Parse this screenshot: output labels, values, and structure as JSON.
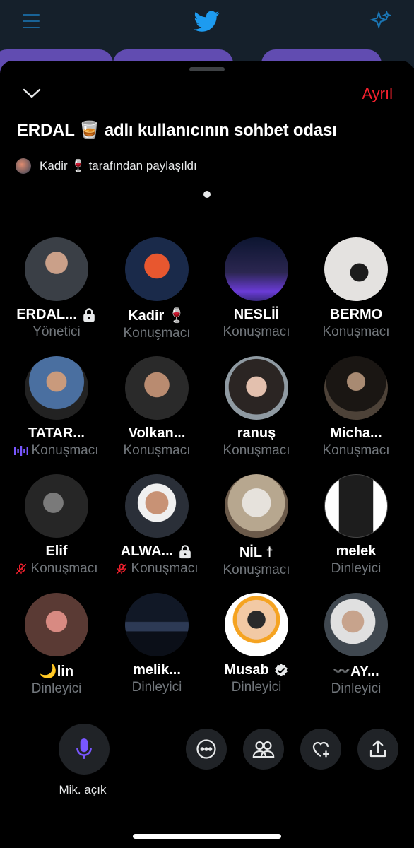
{
  "header": {
    "leave_label": "Ayrıl"
  },
  "room": {
    "title": "ERDAL 🥃 adlı kullanıcının sohbet odası",
    "shared_by_name": "Kadir 🍷",
    "shared_by_suffix": "tarafından paylaşıldı"
  },
  "participants": [
    {
      "name": "ERDAL...",
      "role": "Yönetici",
      "badge": "lock"
    },
    {
      "name": "Kadir 🍷",
      "role": "Konuşmacı"
    },
    {
      "name": "NESLİİ",
      "role": "Konuşmacı"
    },
    {
      "name": "BERMO",
      "role": "Konuşmacı"
    },
    {
      "name": "TATAR...",
      "role": "Konuşmacı",
      "status": "speaking"
    },
    {
      "name": "Volkan...",
      "role": "Konuşmacı"
    },
    {
      "name": "ranuş",
      "role": "Konuşmacı"
    },
    {
      "name": "Micha...",
      "role": "Konuşmacı"
    },
    {
      "name": "Elif",
      "role": "Konuşmacı",
      "status": "muted"
    },
    {
      "name": "ALWA...",
      "role": "Konuşmacı",
      "status": "muted",
      "badge": "lock"
    },
    {
      "name": "NİL ☨",
      "role": "Konuşmacı"
    },
    {
      "name": "melek",
      "role": "Dinleyici"
    },
    {
      "name": "🌙lin",
      "role": "Dinleyici"
    },
    {
      "name": "melik...",
      "role": "Dinleyici"
    },
    {
      "name": "Musab",
      "role": "Dinleyici",
      "badge": "verified"
    },
    {
      "name": "〰️AY...",
      "role": "Dinleyici"
    }
  ],
  "controls": {
    "mic_label": "Mik. açık",
    "actions": [
      "more-icon",
      "people-icon",
      "heart-plus-icon",
      "share-icon"
    ]
  },
  "colors": {
    "accent": "#1d9bf0",
    "leave": "#f4212e",
    "mic": "#7856ff",
    "muted_label": "#f4212e",
    "secondary_text": "#71767b"
  }
}
